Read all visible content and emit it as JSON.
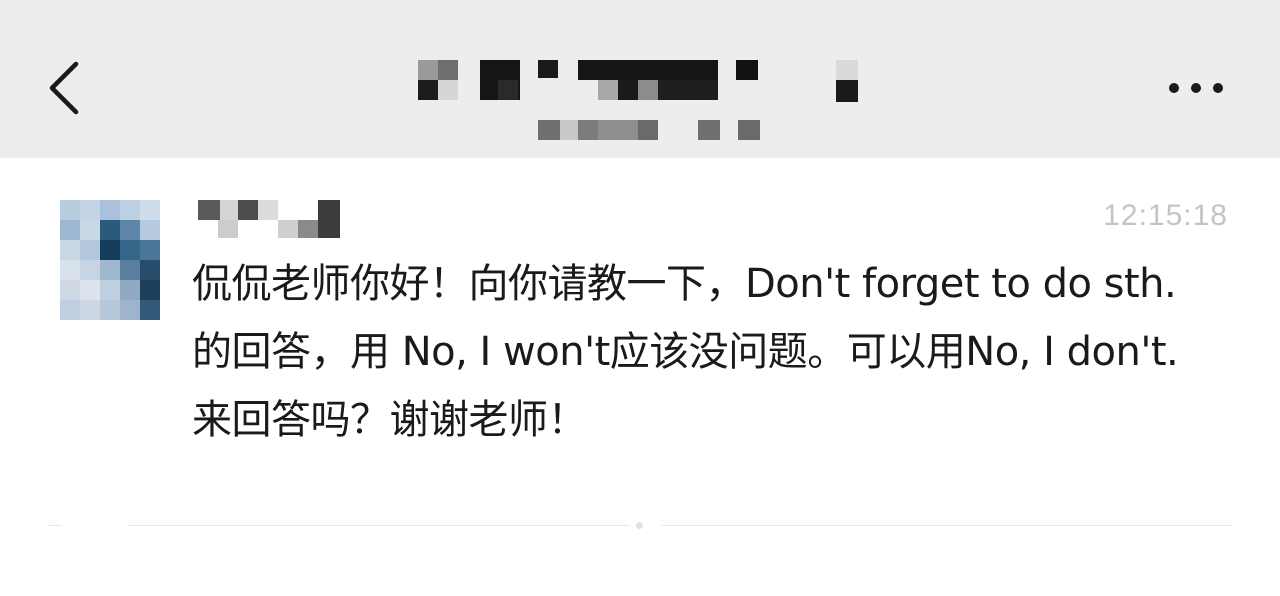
{
  "header": {
    "back_icon": "chevron-left-icon",
    "more_icon": "more-horizontal-icon",
    "title_redacted": true,
    "subtitle_redacted": true,
    "background_color": "#ededed"
  },
  "message": {
    "sender_name_redacted": true,
    "avatar_redacted": true,
    "timestamp": "12:15:18",
    "text": "侃侃老师你好！向你请教一下，Don't forget to do sth.的回答，用 No, I won't应该没问题。可以用No, I don't.来回答吗？谢谢老师！"
  },
  "colors": {
    "page_background": "#ffffff",
    "text": "#1a1a1a",
    "timestamp": "#c4c4c4",
    "divider": "#e8e8e8"
  }
}
